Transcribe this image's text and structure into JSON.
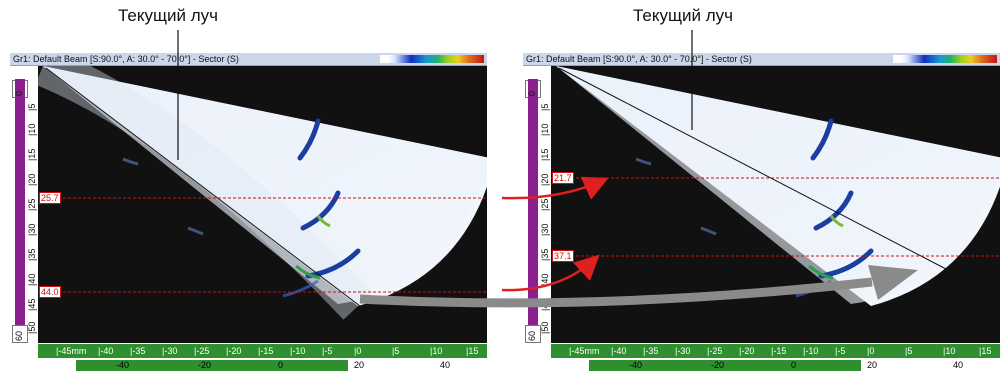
{
  "callouts": {
    "left": "Текущий луч",
    "right": "Текущий луч"
  },
  "panels": [
    {
      "title": "Gr1: Default Beam [S:90.0°, A: 30.0° - 70.0°] - Sector (S)",
      "vruler": {
        "top": "0",
        "ticks": [
          "|5",
          "|10",
          "|15",
          "|20",
          "|25",
          "|30",
          "|35",
          "|40",
          "|45",
          "|50"
        ],
        "bottom": "60"
      },
      "cursors": [
        "25.7",
        "44.0"
      ],
      "hticks": [
        "|-45mm",
        "|-40",
        "|-35",
        "|-30",
        "|-25",
        "|-20",
        "|-15",
        "|-10",
        "|-5",
        "|0",
        "|5",
        "|10",
        "|15"
      ],
      "hscale": [
        "-40",
        "-20",
        "0",
        "20",
        "40"
      ]
    },
    {
      "title": "Gr1: Default Beam [S:90.0°, A: 30.0° - 70.0°] - Sector (S)",
      "vruler": {
        "top": "0",
        "ticks": [
          "|5",
          "|10",
          "|15",
          "|20",
          "|25",
          "|30",
          "|35",
          "|40",
          "|45",
          "|50"
        ],
        "bottom": "60"
      },
      "cursors": [
        "21.7",
        "37.1"
      ],
      "hticks": [
        "|-45mm",
        "|-40",
        "|-35",
        "|-30",
        "|-25",
        "|-20",
        "|-15",
        "|-10",
        "|-5",
        "|0",
        "|5",
        "|10",
        "|15"
      ],
      "hscale": [
        "-40",
        "-20",
        "0",
        "20",
        "40"
      ]
    }
  ],
  "colors": {
    "magenta_ruler": "#8b1f8e",
    "green_ruler": "#2f8f2f",
    "cursor_red": "#d01010",
    "arrow_gray": "#8a8a8a"
  }
}
